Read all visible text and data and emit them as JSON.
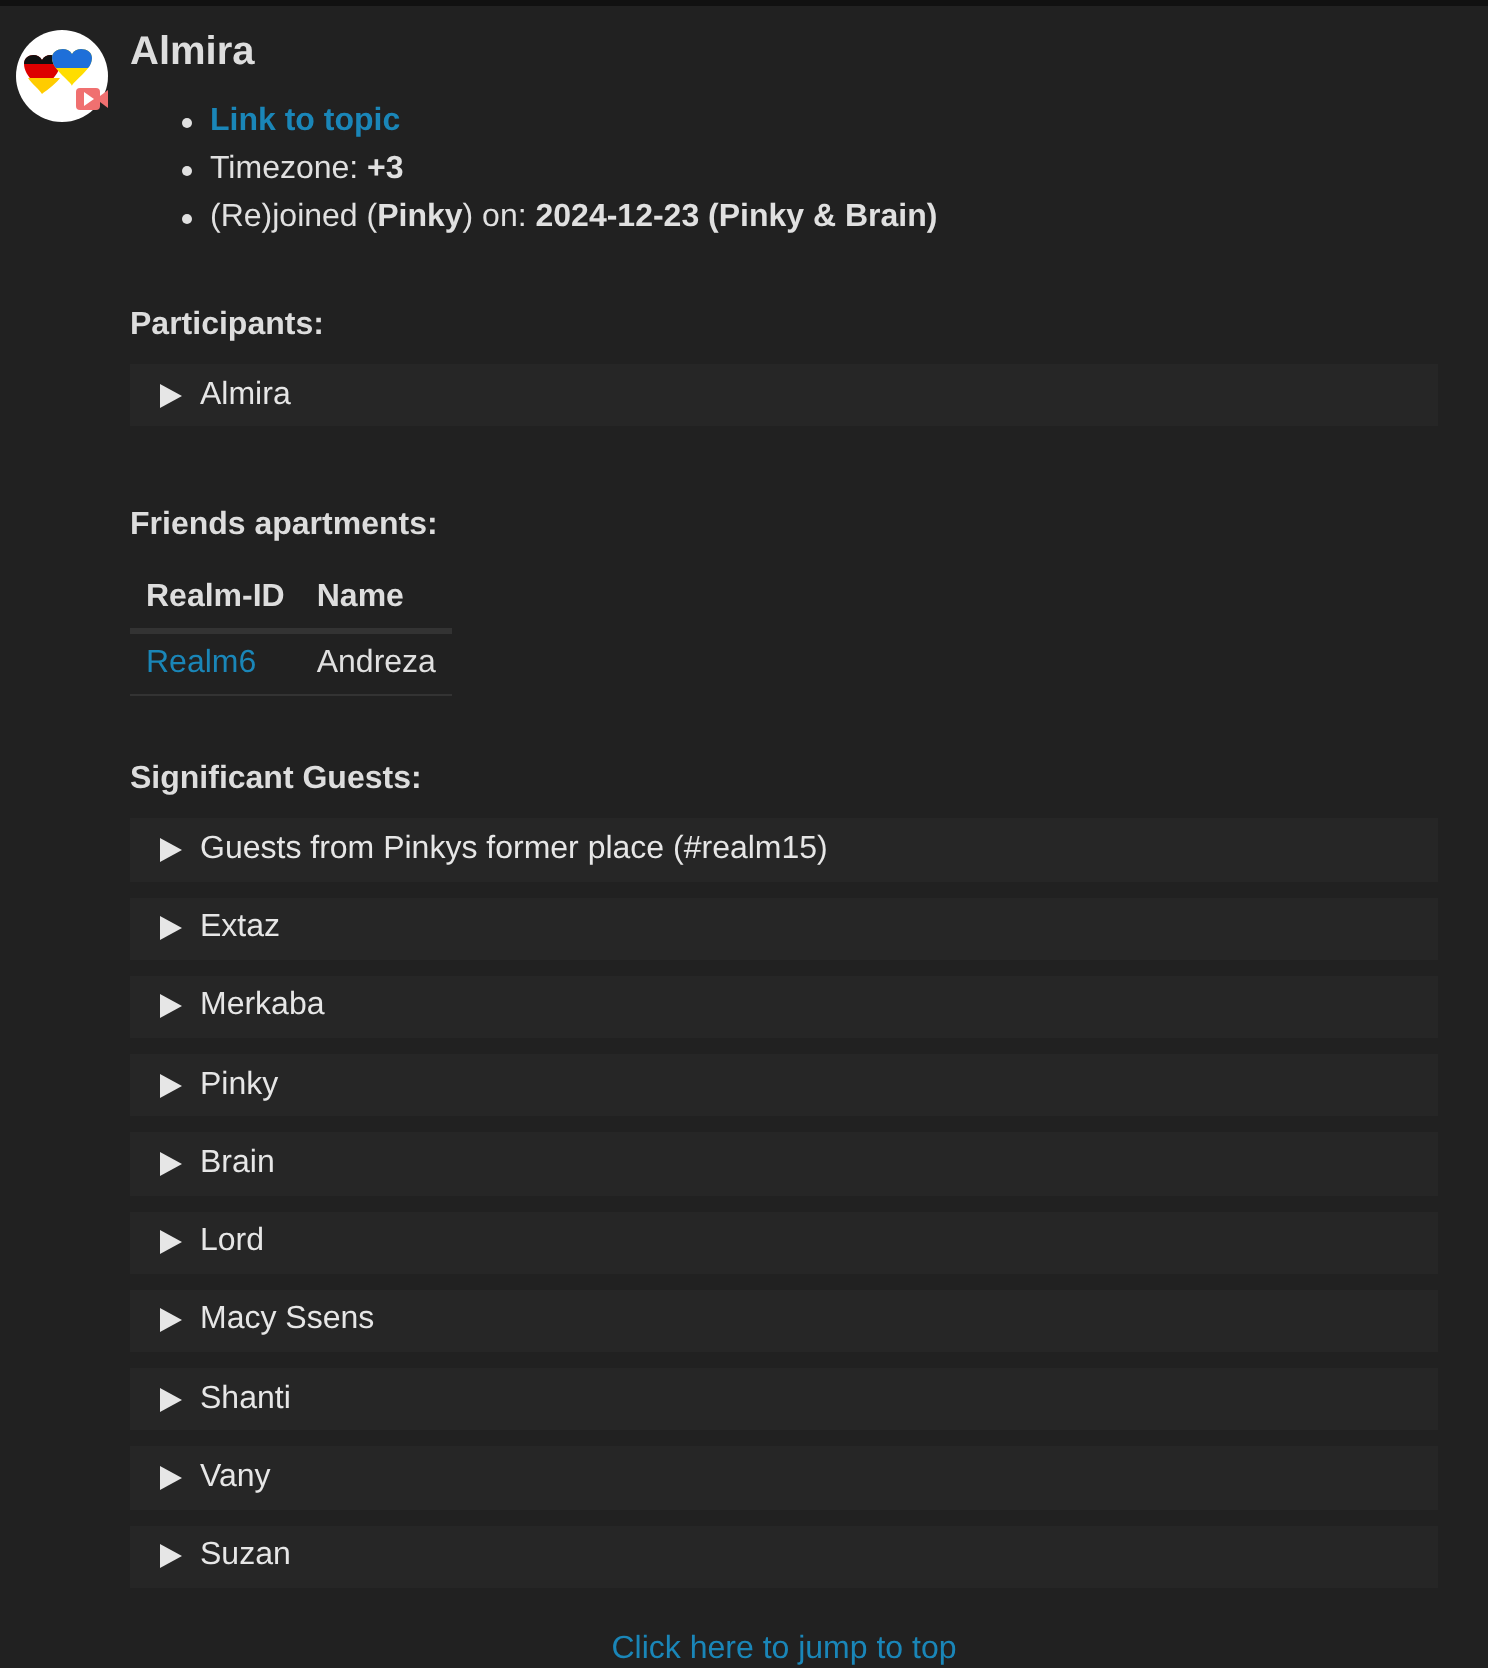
{
  "title": "Almira",
  "info": [
    {
      "kind": "link",
      "text": "Link to topic"
    },
    {
      "kind": "text",
      "text": "Timezone: **+3**"
    },
    {
      "kind": "text",
      "text": "(Re)joined (**Pinky**) on: **2024-12-23 (Pinky & Brain)**"
    }
  ],
  "participants": {
    "heading": "Participants:",
    "items": [
      {
        "label": "Almira",
        "expanded": false
      }
    ]
  },
  "apartments": {
    "heading": "Friends apartments:",
    "columns": [
      "Realm-ID",
      "Name"
    ],
    "rows": [
      [
        "Realm6",
        "Andreza"
      ]
    ]
  },
  "guests": {
    "heading": "Significant Guests:",
    "items": [
      {
        "label": "Guests from Pinkys former place (#realm15)",
        "expanded": false
      },
      {
        "label": "Extaz",
        "expanded": false
      },
      {
        "label": "Merkaba",
        "expanded": false
      },
      {
        "label": "Pinky",
        "expanded": false
      },
      {
        "label": "Brain",
        "expanded": false
      },
      {
        "label": "Lord",
        "expanded": false
      },
      {
        "label": "Macy Ssens",
        "expanded": false
      },
      {
        "label": "Shanti",
        "expanded": false
      },
      {
        "label": "Vany",
        "expanded": false
      },
      {
        "label": "Suzan",
        "expanded": false
      }
    ]
  },
  "footer_link": "Click here to jump to top"
}
